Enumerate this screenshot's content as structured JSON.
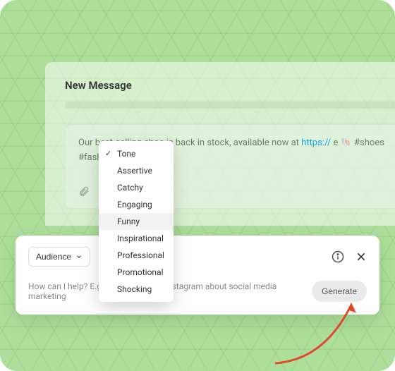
{
  "message": {
    "title": "New Message",
    "compose_text_1": "Our best-selling shoe is back in stock, available now at ",
    "compose_link": "https://",
    "compose_text_2": "e 🐚 #shoes #fashion #shopping"
  },
  "tone_dropdown": {
    "items": [
      "Tone",
      "Assertive",
      "Catchy",
      "Engaging",
      "Funny",
      "Inspirational",
      "Professional",
      "Promotional",
      "Shocking"
    ],
    "selected": "Tone",
    "hovered": "Funny"
  },
  "ai_panel": {
    "audience_label": "Audience",
    "placeholder": "How can I help? E.g. write a post for Instagram about social media marketing",
    "generate_label": "Generate"
  }
}
